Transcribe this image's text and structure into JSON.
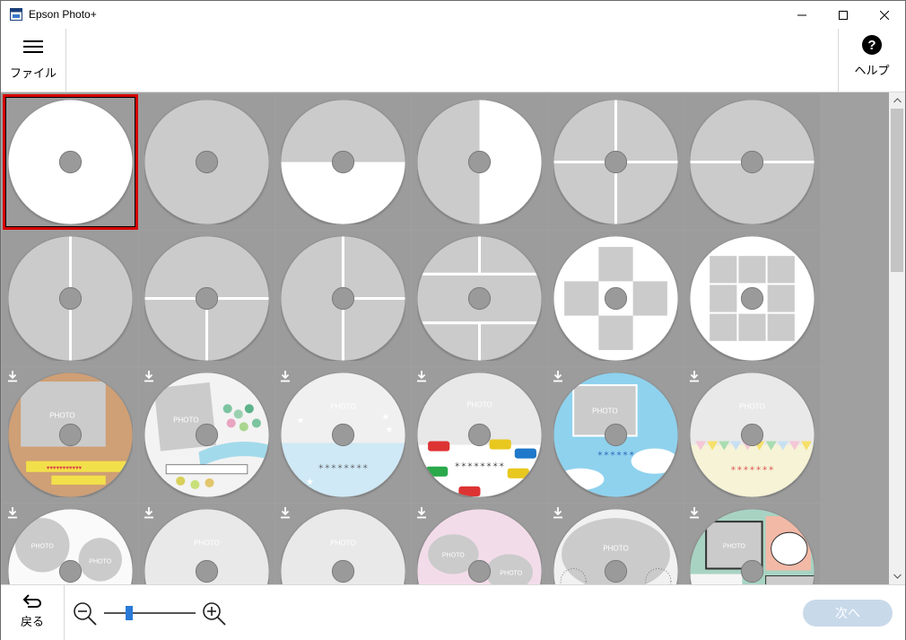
{
  "window": {
    "title": "Epson Photo+",
    "controls": [
      "minimize",
      "maximize",
      "close"
    ]
  },
  "toolbar": {
    "file_label": "ファイル",
    "file_icon": "hamburger-menu-icon",
    "help_label": "ヘルプ",
    "help_icon": "help-circle-icon"
  },
  "gallery": {
    "selected_index": 0,
    "photo_placeholder": "PHOTO",
    "templates": [
      {
        "layout": "blank-white"
      },
      {
        "layout": "full-photo"
      },
      {
        "layout": "half-horizontal"
      },
      {
        "layout": "half-vertical"
      },
      {
        "layout": "quarters"
      },
      {
        "layout": "horizontal-divider"
      },
      {
        "layout": "vertical-divider"
      },
      {
        "layout": "t-split-down"
      },
      {
        "layout": "t-split-right"
      },
      {
        "layout": "triple-rows"
      },
      {
        "layout": "cross-squares"
      },
      {
        "layout": "grid-squares"
      },
      {
        "layout": "kraft-stars",
        "downloadable": true
      },
      {
        "layout": "watercolor-dots",
        "downloadable": true
      },
      {
        "layout": "sky-stars",
        "downloadable": true
      },
      {
        "layout": "cars",
        "downloadable": true
      },
      {
        "layout": "sky-birds",
        "downloadable": true
      },
      {
        "layout": "bunting",
        "downloadable": true
      },
      {
        "layout": "balloons-two-photo",
        "downloadable": true
      },
      {
        "layout": "stamps",
        "downloadable": true
      },
      {
        "layout": "green-stripe",
        "downloadable": true
      },
      {
        "layout": "pink-cloud-two-photo",
        "downloadable": true
      },
      {
        "layout": "lace",
        "downloadable": true
      },
      {
        "layout": "comic-panels",
        "downloadable": true
      }
    ]
  },
  "bottombar": {
    "back_label": "戻る",
    "back_icon": "back-arrow-icon",
    "zoom_out_icon": "zoom-out-icon",
    "zoom_in_icon": "zoom-in-icon",
    "zoom_level": 0.27,
    "next_label": "次へ",
    "next_enabled": false
  },
  "colors": {
    "selection": "#d40000",
    "accent": "#2a7ad8",
    "gallery_bg": "#a0a0a0",
    "next_disabled_bg": "#c8d9ea"
  }
}
